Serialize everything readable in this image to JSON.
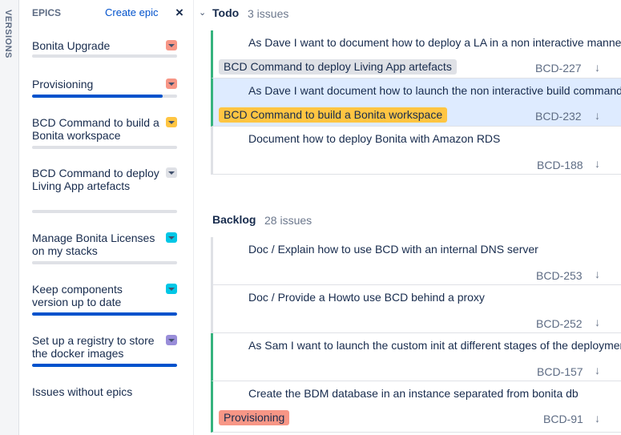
{
  "versions_label": "VERSIONS",
  "epics": {
    "title": "EPICS",
    "create_label": "Create epic",
    "close_glyph": "×",
    "items": [
      {
        "name": "Bonita Upgrade",
        "color": "#f79686",
        "progress": 0
      },
      {
        "name": "Provisioning",
        "color": "#f79686",
        "progress": 0.9
      },
      {
        "name": "BCD Command to build a Bonita workspace",
        "color": "#ffc542",
        "progress": 0
      },
      {
        "name": "BCD Command to deploy Living App artefacts",
        "color": "#dfe1e6",
        "progress": 0
      },
      {
        "name": "Manage Bonita Licenses on my stacks",
        "color": "#00c7e6",
        "progress": 0
      },
      {
        "name": "Keep components version up to date",
        "color": "#00c7e6",
        "progress": 1.0
      },
      {
        "name": "Set up a registry to store the docker images",
        "color": "#998dd9",
        "progress": 1.0
      }
    ],
    "no_epics_label": "Issues without epics"
  },
  "todo": {
    "chevron": "⌄",
    "title": "Todo",
    "count": "3 issues",
    "issues": [
      {
        "type": "story",
        "summary": "As Dave I want to document how to deploy a LA in a non interactive manner",
        "epic": "BCD Command to deploy Living App artefacts",
        "epic_color": "#dfe1e6",
        "key": "BCD-227",
        "arrow": "↓"
      },
      {
        "type": "story",
        "summary": "As Dave I want document how to launch the non interactive build command",
        "epic": "BCD Command to build a Bonita workspace",
        "epic_color": "#ffc542",
        "key": "BCD-232",
        "arrow": "↓"
      },
      {
        "type": "task",
        "summary": "Document how to deploy Bonita with Amazon RDS",
        "epic": "",
        "key": "BCD-188",
        "arrow": "↓"
      }
    ]
  },
  "backlog": {
    "title": "Backlog",
    "count": "28 issues",
    "issues": [
      {
        "type": "task",
        "summary": "Doc / Explain how to use BCD with an internal DNS server",
        "epic": "",
        "key": "BCD-253",
        "arrow": "↓"
      },
      {
        "type": "task",
        "summary": "Doc / Provide a Howto use BCD behind a proxy",
        "epic": "",
        "key": "BCD-252",
        "arrow": "↓"
      },
      {
        "type": "story",
        "summary": "As Sam I want to launch the custom init at different stages of the deployment",
        "epic": "",
        "key": "BCD-157",
        "arrow": "↓"
      },
      {
        "type": "improvement",
        "summary": "Create the BDM database in an instance separated from bonita db",
        "epic": "Provisioning",
        "epic_color": "#f79686",
        "key": "BCD-91",
        "arrow": "↓"
      }
    ]
  }
}
